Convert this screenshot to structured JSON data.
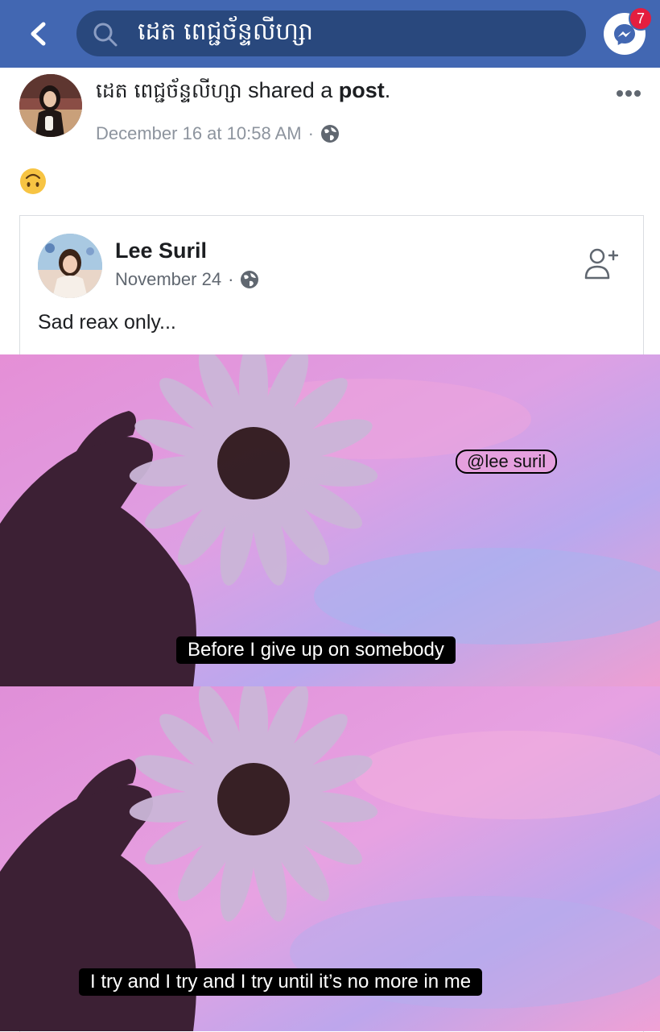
{
  "header": {
    "search_query": "ដេត ពេជ្ជច័ន្ទលីហ្សា",
    "messenger_badge": "7",
    "colors": {
      "bar": "#4267b2",
      "search_bg": "#29487d"
    }
  },
  "share": {
    "sharer_name": "ដេត ពេជ្ជច័ន្ទលីហ្សា",
    "action_text": "shared a",
    "object_text": "post",
    "punct": ".",
    "timestamp": "December 16 at 10:58 AM",
    "separator": "·",
    "emoji": "upside-down-face-emoji"
  },
  "original_post": {
    "author_name": "Lee Suril",
    "date": "November 24",
    "separator": "·",
    "text": "Sad reax only...",
    "watermark": "@lee suril",
    "caption_1": "Before I give up on somebody",
    "caption_2": "I try and I try and I try until it’s no more in me"
  },
  "icons": [
    "back-icon",
    "search-icon",
    "messenger-icon",
    "more-options-icon",
    "globe-icon",
    "add-friend-icon"
  ]
}
